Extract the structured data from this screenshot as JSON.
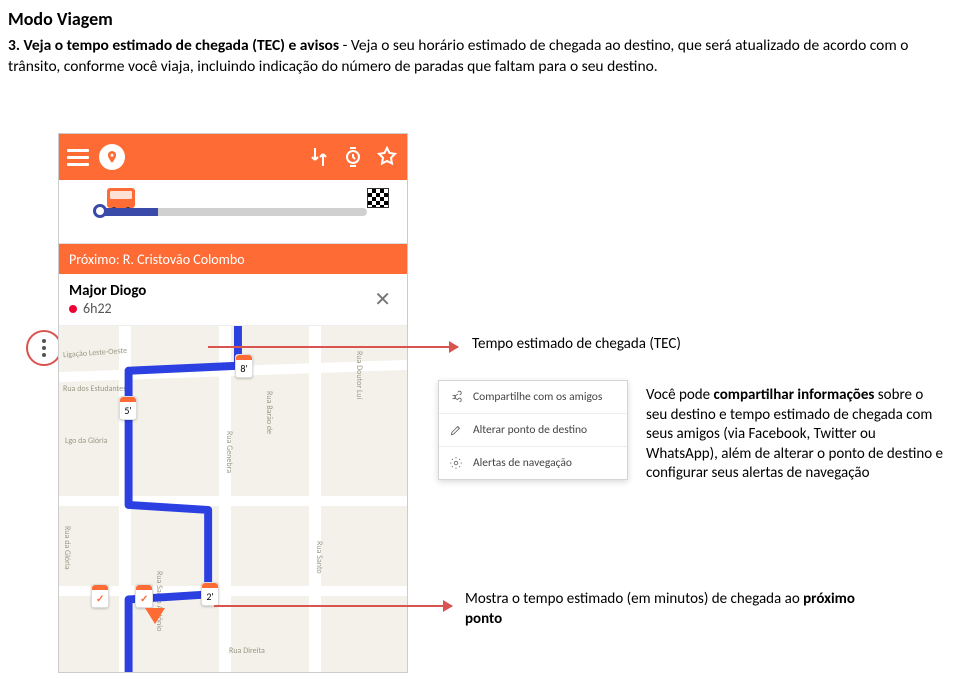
{
  "title": "Modo Viagem",
  "body_lead": "3. Veja o tempo estimado de chegada (TEC) e avisos",
  "body_rest": " - Veja o seu horário estimado de chegada ao destino, que será atualizado de acordo com o trânsito, conforme você viaja, incluindo indicação do número de paradas que faltam para o seu destino.",
  "phone": {
    "next_banner": "Próximo: R. Cristovão Colombo",
    "stop_name": "Major Diogo",
    "stop_time": "6h22",
    "map_bubbles": {
      "b1": "8'",
      "b2": "5'",
      "b3": "2'"
    },
    "street_labels": [
      "Lgo da Glória",
      "Rua da Glória",
      "Rua Santo Antônio",
      "Rua Doutor Luí",
      "Rua Barão de",
      "Rua Genebra",
      "Rua Santo",
      "Rua Direita",
      "Ligação Leste-Oeste",
      "Rua dos Estudantes"
    ]
  },
  "popover": {
    "items": [
      "Compartilhe com os amigos",
      "Alterar ponto de destino",
      "Alertas de navegação"
    ]
  },
  "callouts": {
    "tec": "Tempo estimado de chegada (TEC)",
    "share_pre": "Você pode ",
    "share_bold": "compartilhar informações",
    "share_post": " sobre o seu destino e tempo estimado de chegada com seus amigos (via Facebook, Twitter ou WhatsApp), além de alterar o ponto de destino e configurar seus alertas de navegação",
    "bottom_pre": "Mostra o tempo estimado (em minutos) de chegada ao ",
    "bottom_bold": "próximo ponto"
  }
}
